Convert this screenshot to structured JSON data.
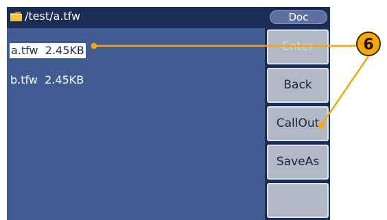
{
  "title": {
    "path": "/test/a.tfw",
    "mode": "Doc"
  },
  "files": [
    {
      "name": "a.tfw",
      "size": "2.45KB",
      "selected": true
    },
    {
      "name": "b.tfw",
      "size": "2.45KB",
      "selected": false
    }
  ],
  "softkeys": [
    {
      "label": "Enter",
      "enabled": false
    },
    {
      "label": "Back",
      "enabled": true
    },
    {
      "label": "CallOut",
      "enabled": true
    },
    {
      "label": "SaveAs",
      "enabled": true
    },
    {
      "label": "",
      "enabled": true
    }
  ],
  "callout": {
    "number": "6",
    "color": "#f7a800"
  },
  "icons": {
    "folder": "folder-icon"
  }
}
